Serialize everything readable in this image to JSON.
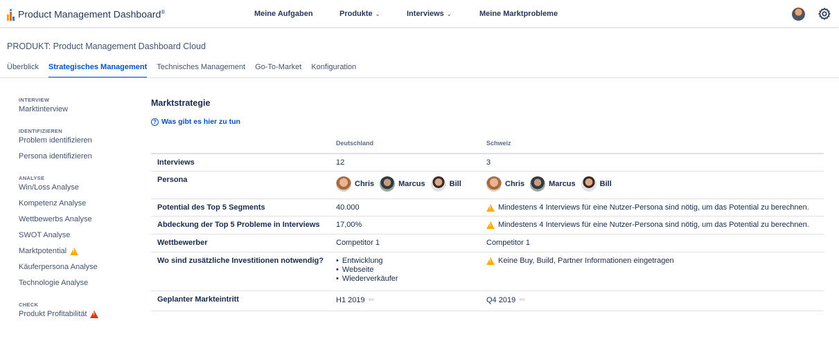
{
  "nav": {
    "logo_text": "Product Management Dashboard",
    "logo_reg": "®",
    "items": [
      {
        "label": "Meine Aufgaben",
        "dropdown": false
      },
      {
        "label": "Produkte",
        "dropdown": true
      },
      {
        "label": "Interviews",
        "dropdown": true
      },
      {
        "label": "Meine Marktprobleme",
        "dropdown": false
      }
    ],
    "chevron": "⌄"
  },
  "product_title": "PRODUKT: Product Management Dashboard Cloud",
  "tabs": [
    {
      "label": "Überblick",
      "active": false
    },
    {
      "label": "Strategisches Management",
      "active": true
    },
    {
      "label": "Technisches Management",
      "active": false
    },
    {
      "label": "Go-To-Market",
      "active": false
    },
    {
      "label": "Konfiguration",
      "active": false
    }
  ],
  "sidebar": {
    "groups": [
      {
        "title": "INTERVIEW",
        "items": [
          {
            "label": "Marktinterview"
          }
        ]
      },
      {
        "title": "IDENTIFIZIEREN",
        "items": [
          {
            "label": "Problem identifizieren"
          },
          {
            "label": "Persona identifizieren"
          }
        ]
      },
      {
        "title": "ANALYSE",
        "items": [
          {
            "label": "Win/Loss Analyse"
          },
          {
            "label": "Kompetenz Analyse"
          },
          {
            "label": "Wettbewerbs Analyse"
          },
          {
            "label": "SWOT Analyse"
          },
          {
            "label": "Marktpotential",
            "status": "warning"
          },
          {
            "label": "Käuferpersona Analyse"
          },
          {
            "label": "Technologie Analyse"
          }
        ]
      },
      {
        "title": "CHECK",
        "items": [
          {
            "label": "Produkt Profitabilität",
            "status": "error"
          }
        ]
      }
    ]
  },
  "main": {
    "title": "Marktstrategie",
    "help_link": "Was gibt es hier zu tun",
    "columns": [
      "Deutschland",
      "Schweiz"
    ],
    "rows": {
      "interviews": {
        "label": "Interviews",
        "de": "12",
        "ch": "3"
      },
      "persona": {
        "label": "Persona",
        "names": [
          "Chris",
          "Marcus",
          "Bill"
        ]
      },
      "potential": {
        "label": "Potential des Top 5 Segments",
        "de": "40.000",
        "ch": "Mindestens 4 Interviews für eine Nutzer-Persona sind nötig, um das Potential zu berechnen."
      },
      "abdeckung": {
        "label": "Abdeckung der Top 5 Probleme in Interviews",
        "de": "17,00%",
        "ch": "Mindestens 4 Interviews für eine Nutzer-Persona sind nötig, um das Potential zu berechnen."
      },
      "wettbewerber": {
        "label": "Wettbewerber",
        "de": "Competitor 1",
        "ch": "Competitor 1"
      },
      "investitionen": {
        "label": "Wo sind zusätzliche Investitionen notwendig?",
        "de": [
          "Entwicklung",
          "Webseite",
          "Wiederverkäufer"
        ],
        "ch": "Keine Buy, Build, Partner Informationen eingetragen"
      },
      "markteintritt": {
        "label": "Geplanter Markteintritt",
        "de": "H1 2019",
        "ch": "Q4 2019"
      }
    }
  },
  "colors": {
    "accent": "#0052cc",
    "warning": "#ffab00",
    "error": "#de350b"
  }
}
